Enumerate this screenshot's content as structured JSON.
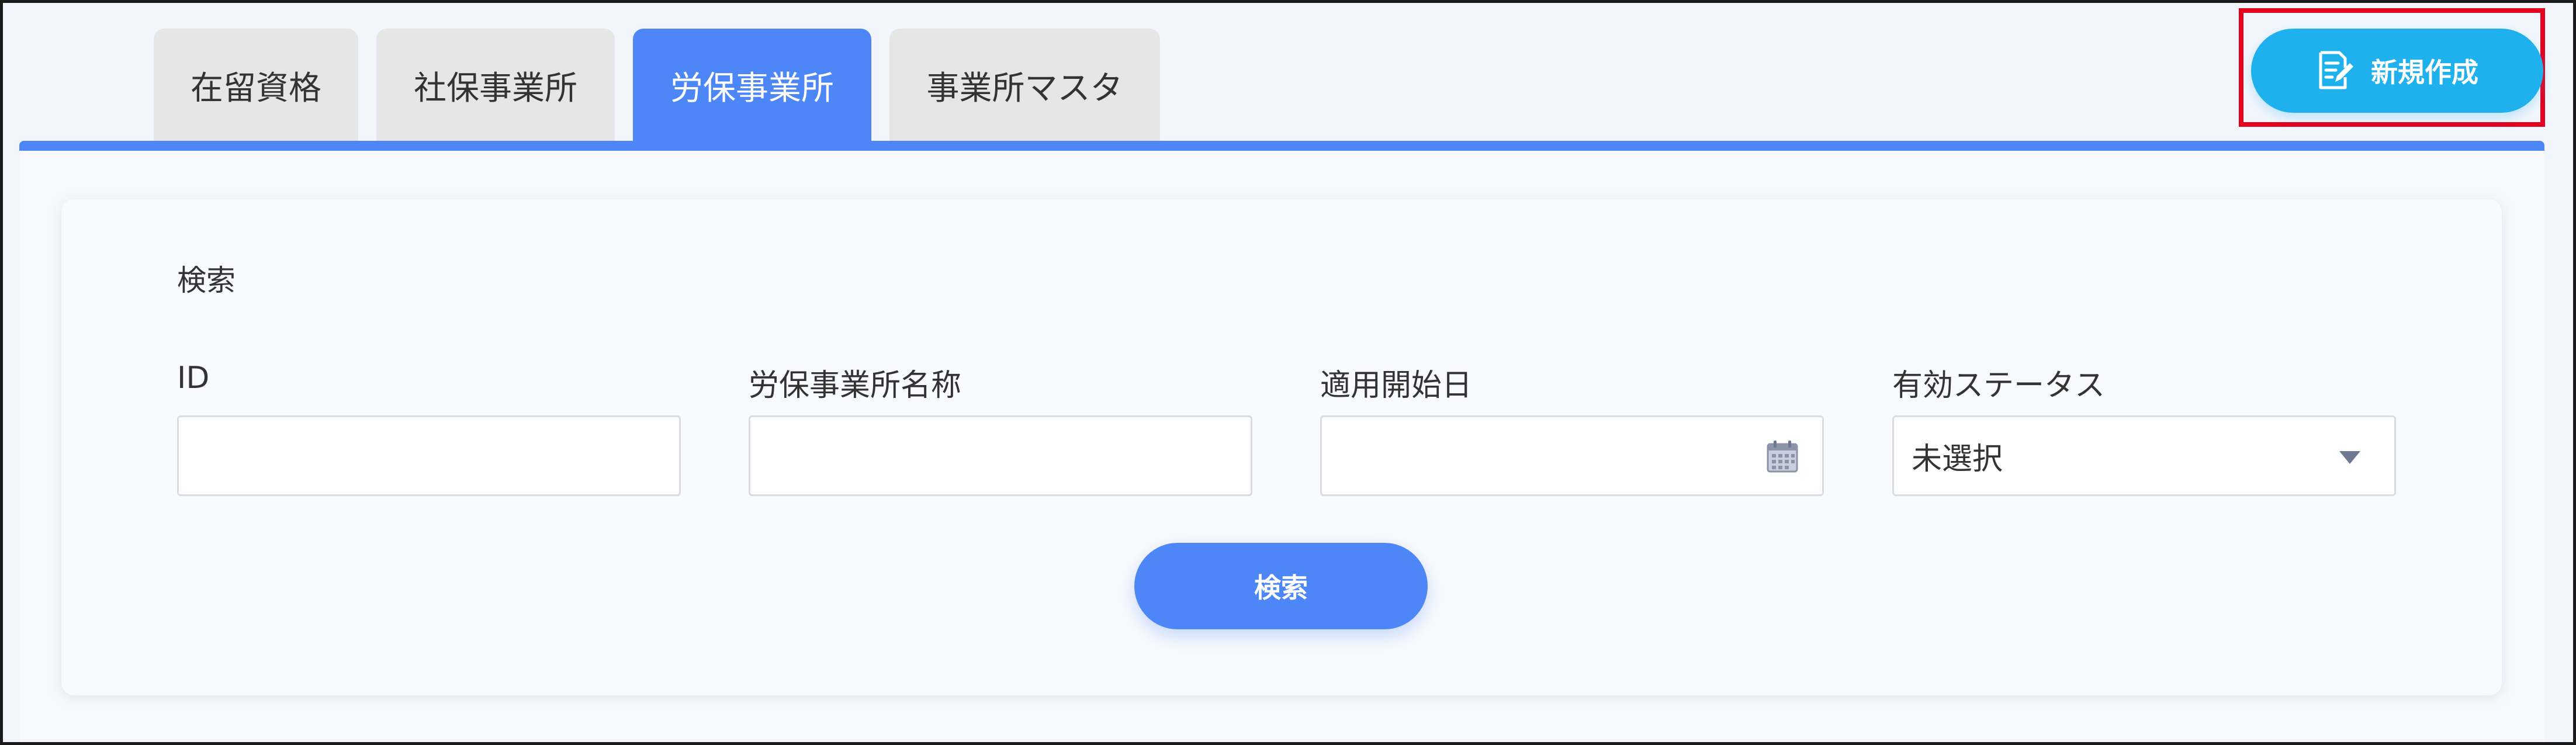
{
  "tabs": [
    {
      "label": "在留資格",
      "active": false
    },
    {
      "label": "社保事業所",
      "active": false
    },
    {
      "label": "労保事業所",
      "active": true
    },
    {
      "label": "事業所マスタ",
      "active": false
    }
  ],
  "header": {
    "new_button_label": "新規作成",
    "new_button_icon": "edit-document-icon"
  },
  "search": {
    "title": "検索",
    "fields": {
      "id": {
        "label": "ID",
        "value": ""
      },
      "office_name": {
        "label": "労保事業所名称",
        "value": ""
      },
      "start_date": {
        "label": "適用開始日",
        "value": "",
        "icon": "calendar-icon"
      },
      "status": {
        "label": "有効ステータス",
        "selected": "未選択"
      }
    },
    "button_label": "検索"
  },
  "colors": {
    "primary": "#4d86f7",
    "accent": "#1fb0ee",
    "highlight_border": "#e5001e",
    "tab_inactive": "#e6e6e6"
  }
}
